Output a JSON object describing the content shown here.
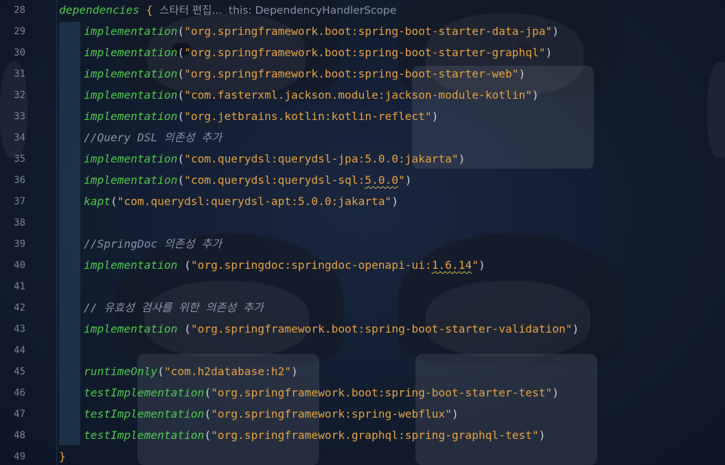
{
  "editor": {
    "lines": [
      {
        "num": "28",
        "tokens": [
          {
            "t": "dependencies",
            "c": "fn"
          },
          {
            "t": " ",
            "c": "punct"
          },
          {
            "t": "{",
            "c": "brace"
          }
        ]
      },
      {
        "num": "29",
        "tokens": [
          {
            "t": "implementation",
            "c": "fn"
          },
          {
            "t": "(",
            "c": "punct"
          },
          {
            "t": "\"org.springframework.boot:spring-boot-starter-data-jpa\"",
            "c": "str"
          },
          {
            "t": ")",
            "c": "punct"
          }
        ]
      },
      {
        "num": "30",
        "tokens": [
          {
            "t": "implementation",
            "c": "fn"
          },
          {
            "t": "(",
            "c": "punct"
          },
          {
            "t": "\"org.springframework.boot:spring-boot-starter-graphql\"",
            "c": "str"
          },
          {
            "t": ")",
            "c": "punct"
          }
        ]
      },
      {
        "num": "31",
        "tokens": [
          {
            "t": "implementation",
            "c": "fn"
          },
          {
            "t": "(",
            "c": "punct"
          },
          {
            "t": "\"org.springframework.boot:spring-boot-starter-web\"",
            "c": "str"
          },
          {
            "t": ")",
            "c": "punct"
          }
        ]
      },
      {
        "num": "32",
        "tokens": [
          {
            "t": "implementation",
            "c": "fn"
          },
          {
            "t": "(",
            "c": "punct"
          },
          {
            "t": "\"com.fasterxml.jackson.module:jackson-module-kotlin\"",
            "c": "str"
          },
          {
            "t": ")",
            "c": "punct"
          }
        ]
      },
      {
        "num": "33",
        "tokens": [
          {
            "t": "implementation",
            "c": "fn"
          },
          {
            "t": "(",
            "c": "punct"
          },
          {
            "t": "\"org.jetbrains.kotlin:kotlin-reflect\"",
            "c": "str"
          },
          {
            "t": ")",
            "c": "punct"
          }
        ]
      },
      {
        "num": "34",
        "tokens": [
          {
            "t": "//Query DSL 의존성 추가",
            "c": "cmt"
          }
        ]
      },
      {
        "num": "35",
        "tokens": [
          {
            "t": "implementation",
            "c": "fn"
          },
          {
            "t": "(",
            "c": "punct"
          },
          {
            "t": "\"com.querydsl:querydsl-jpa:5.0.0:jakarta\"",
            "c": "str"
          },
          {
            "t": ")",
            "c": "punct"
          }
        ]
      },
      {
        "num": "36",
        "tokens": [
          {
            "t": "implementation",
            "c": "fn"
          },
          {
            "t": "(",
            "c": "punct"
          },
          {
            "t": "\"com.querydsl:querydsl-sql:",
            "c": "str"
          },
          {
            "t": "5.0.0",
            "c": "str squig"
          },
          {
            "t": "\"",
            "c": "str"
          },
          {
            "t": ")",
            "c": "punct"
          }
        ]
      },
      {
        "num": "37",
        "tokens": [
          {
            "t": "kapt",
            "c": "fn"
          },
          {
            "t": "(",
            "c": "punct"
          },
          {
            "t": "\"com.querydsl:querydsl-apt:5.0.0:jakarta\"",
            "c": "str"
          },
          {
            "t": ")",
            "c": "punct"
          }
        ]
      },
      {
        "num": "38",
        "tokens": []
      },
      {
        "num": "39",
        "tokens": [
          {
            "t": "//SpringDoc 의존성 추가",
            "c": "cmt"
          }
        ]
      },
      {
        "num": "40",
        "tokens": [
          {
            "t": "implementation",
            "c": "fn"
          },
          {
            "t": " (",
            "c": "punct"
          },
          {
            "t": "\"org.springdoc:springdoc-openapi-ui:",
            "c": "str"
          },
          {
            "t": "1.6.14",
            "c": "str squig"
          },
          {
            "t": "\"",
            "c": "str"
          },
          {
            "t": ")",
            "c": "punct"
          }
        ]
      },
      {
        "num": "41",
        "tokens": []
      },
      {
        "num": "42",
        "tokens": [
          {
            "t": "// 유효성 검사를 위한 의존성 추가",
            "c": "cmt"
          }
        ]
      },
      {
        "num": "43",
        "tokens": [
          {
            "t": "implementation",
            "c": "fn"
          },
          {
            "t": " (",
            "c": "punct"
          },
          {
            "t": "\"org.springframework.boot:spring-boot-starter-validation\"",
            "c": "str"
          },
          {
            "t": ")",
            "c": "punct"
          }
        ]
      },
      {
        "num": "44",
        "tokens": []
      },
      {
        "num": "45",
        "tokens": [
          {
            "t": "runtimeOnly",
            "c": "fn"
          },
          {
            "t": "(",
            "c": "punct"
          },
          {
            "t": "\"com.h2database:h2\"",
            "c": "str"
          },
          {
            "t": ")",
            "c": "punct"
          }
        ]
      },
      {
        "num": "46",
        "tokens": [
          {
            "t": "testImplementation",
            "c": "fn"
          },
          {
            "t": "(",
            "c": "punct"
          },
          {
            "t": "\"org.springframework.boot:spring-boot-starter-test\"",
            "c": "str"
          },
          {
            "t": ")",
            "c": "punct"
          }
        ]
      },
      {
        "num": "47",
        "tokens": [
          {
            "t": "testImplementation",
            "c": "fn"
          },
          {
            "t": "(",
            "c": "punct"
          },
          {
            "t": "\"org.springframework:spring-webflux\"",
            "c": "str"
          },
          {
            "t": ")",
            "c": "punct"
          }
        ]
      },
      {
        "num": "48",
        "tokens": [
          {
            "t": "testImplementation",
            "c": "fn"
          },
          {
            "t": "(",
            "c": "punct"
          },
          {
            "t": "\"org.springframework.graphql:spring-graphql-test\"",
            "c": "str"
          },
          {
            "t": ")",
            "c": "punct"
          }
        ]
      },
      {
        "num": "49",
        "tokens": [
          {
            "t": "}",
            "c": "brace"
          }
        ]
      }
    ],
    "inlay_hint": {
      "label": "스타터 편집...",
      "scope": "this: DependencyHandlerScope"
    }
  },
  "colors": {
    "background": "#111c2e",
    "function": "#4ec94e",
    "string": "#e6a243",
    "comment": "#8a94a6",
    "line_number": "#7a8496",
    "warning_squiggle": "#d8c24a"
  }
}
